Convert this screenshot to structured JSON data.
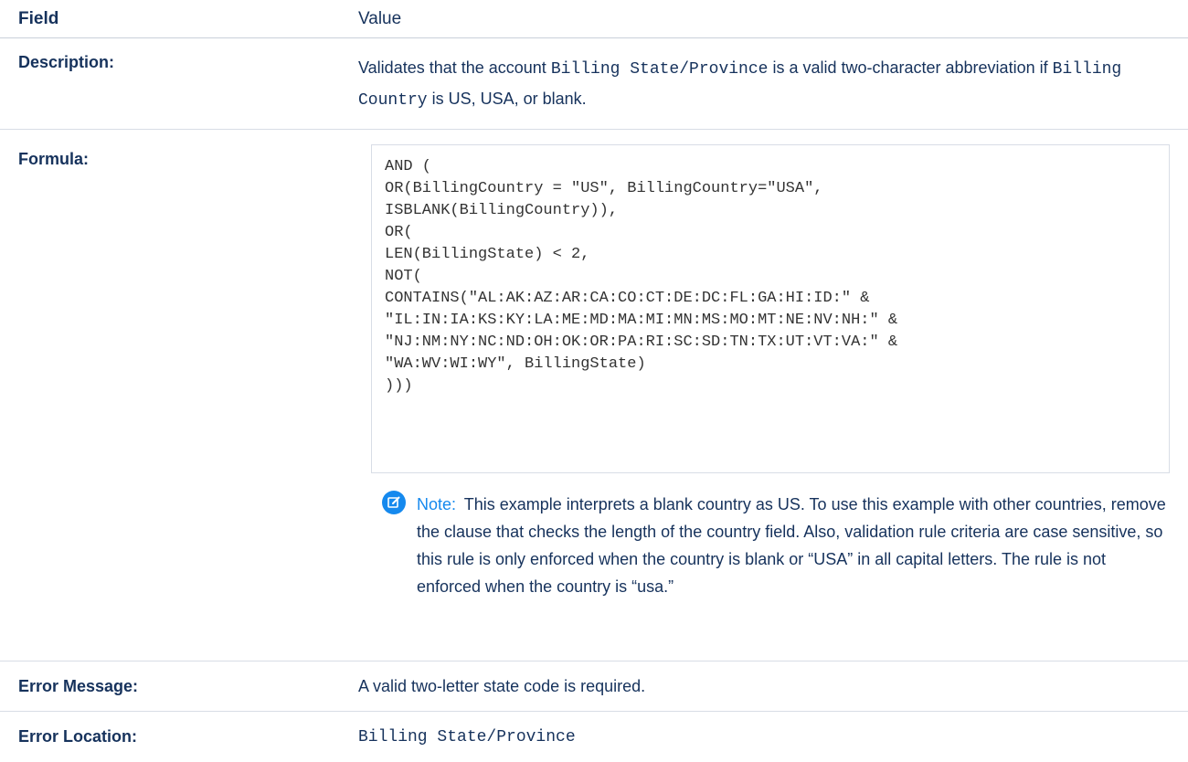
{
  "header": {
    "field_label": "Field",
    "value_label": "Value"
  },
  "rows": {
    "description": {
      "label": "Description:",
      "text_1": "Validates that the account ",
      "code_1": "Billing State/Province",
      "text_2": " is a valid two-character abbreviation if ",
      "code_2": "Billing Country",
      "text_3": " is US, USA, or blank."
    },
    "formula": {
      "label": "Formula:",
      "code": "AND (\nOR(BillingCountry = \"US\", BillingCountry=\"USA\",\nISBLANK(BillingCountry)),\nOR(\nLEN(BillingState) < 2,\nNOT(\nCONTAINS(\"AL:AK:AZ:AR:CA:CO:CT:DE:DC:FL:GA:HI:ID:\" &\n\"IL:IN:IA:KS:KY:LA:ME:MD:MA:MI:MN:MS:MO:MT:NE:NV:NH:\" &\n\"NJ:NM:NY:NC:ND:OH:OK:OR:PA:RI:SC:SD:TN:TX:UT:VT:VA:\" &\n\"WA:WV:WI:WY\", BillingState)\n)))"
    },
    "note": {
      "icon": "edit-note-icon",
      "label": "Note:",
      "text": "This example interprets a blank country as US. To use this example with other countries, remove the clause that checks the length of the country field. Also, validation rule criteria are case sensitive, so this rule is only enforced when the country is blank or “USA” in all capital letters. The rule is not enforced when the country is “usa.”"
    },
    "error_message": {
      "label": "Error Message:",
      "value": "A valid two-letter state code is required."
    },
    "error_location": {
      "label": "Error Location:",
      "value": "Billing State/Province"
    }
  },
  "colors": {
    "text": "#16325c",
    "accent": "#1589ee",
    "border": "#d8dde6"
  }
}
